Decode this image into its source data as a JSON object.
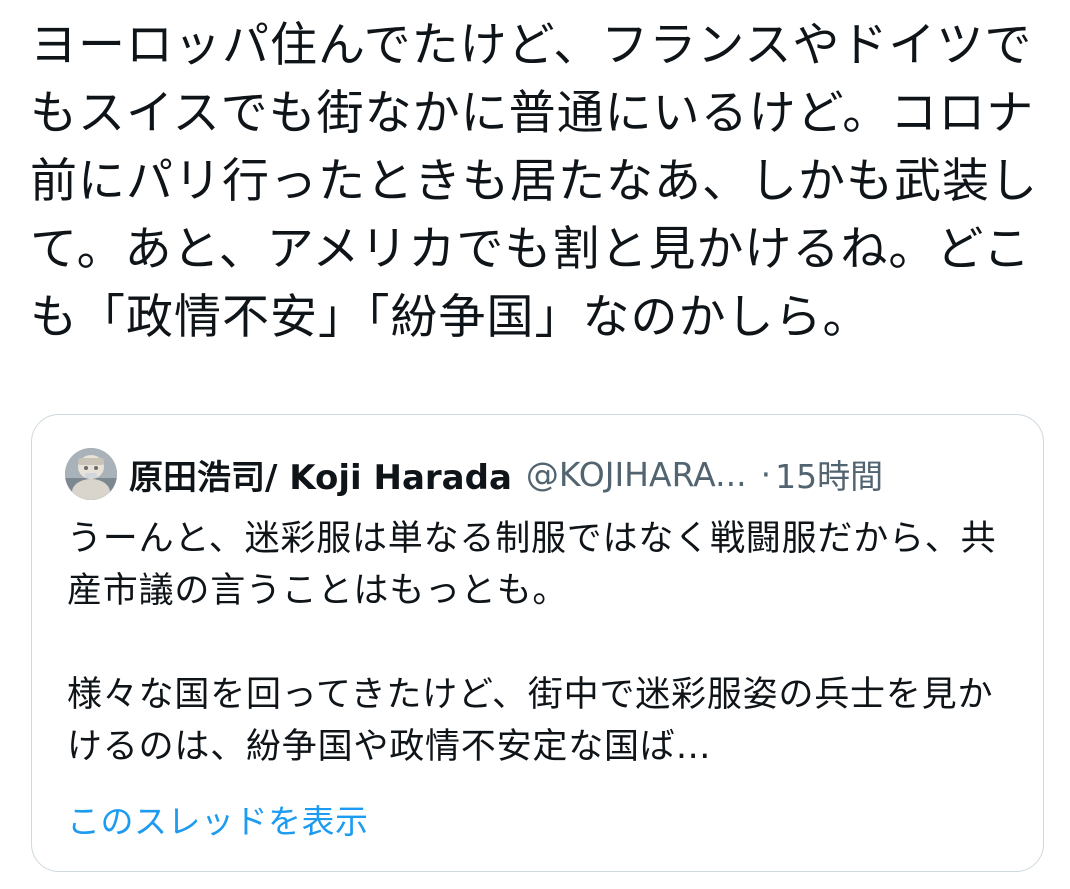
{
  "tweet": {
    "text": "ヨーロッパ住んでたけど、フランスやドイツでもスイスでも街なかに普通にいるけど。コロナ前にパリ行ったときも居たなあ、しかも武装して。あと、アメリカでも割と見かけるね。どこも「政情不安」「紛争国」なのかしら。"
  },
  "quote": {
    "author_name": "原田浩司/ Koji Harada",
    "handle": "@KOJIHARA...",
    "separator": "·",
    "time": "15時間",
    "text": "うーんと、迷彩服は単なる制服ではなく戦闘服だから、共産市議の言うことはもっとも。\n\n様々な国を回ってきたけど、街中で迷彩服姿の兵士を見かけるのは、紛争国や政情不安定な国ば…",
    "show_thread_label": "このスレッドを表示"
  },
  "colors": {
    "text_primary": "#0f1419",
    "text_secondary": "#536471",
    "link": "#1d9bf0",
    "border": "#cfd9de"
  },
  "icons": {
    "avatar": "profile-photo"
  }
}
